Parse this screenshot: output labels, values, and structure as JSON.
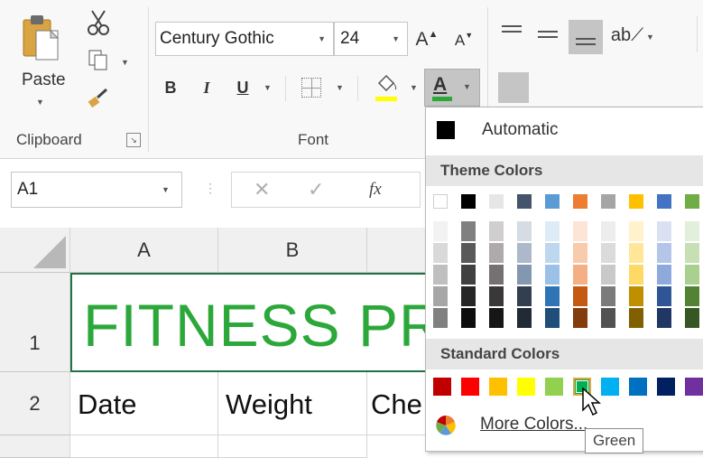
{
  "clipboard": {
    "paste_label": "Paste",
    "group_label": "Clipboard"
  },
  "font": {
    "font_name": "Century Gothic",
    "font_size": "24",
    "grow_label": "A",
    "shrink_label": "A",
    "bold_label": "B",
    "italic_label": "I",
    "underline_label": "U",
    "font_color_label": "A",
    "group_label": "Font",
    "font_color_accent": "#2ca83a",
    "highlight_accent": "#ffff00"
  },
  "formula_bar": {
    "name_box": "A1",
    "fx_label": "fx"
  },
  "sheet": {
    "columns": [
      "A",
      "B"
    ],
    "rows": [
      "1",
      "2"
    ],
    "title_text": "FITNESS PR",
    "title_color": "#2ca83a",
    "row2": [
      "Date",
      "Weight",
      "Che"
    ]
  },
  "color_menu": {
    "automatic_label": "Automatic",
    "theme_header": "Theme Colors",
    "standard_header": "Standard Colors",
    "more_colors_label": "More Colors...",
    "tooltip": "Green",
    "theme_top": [
      "#ffffff",
      "#000000",
      "#e7e6e6",
      "#44546a",
      "#5b9bd5",
      "#ed7d31",
      "#a5a5a5",
      "#ffc000",
      "#4472c4",
      "#70ad47"
    ],
    "theme_shades": [
      [
        "#f2f2f2",
        "#d9d9d9",
        "#bfbfbf",
        "#a6a6a6",
        "#808080"
      ],
      [
        "#808080",
        "#595959",
        "#404040",
        "#262626",
        "#0d0d0d"
      ],
      [
        "#d0cece",
        "#aeaaaa",
        "#757171",
        "#3a3838",
        "#171616"
      ],
      [
        "#d6dce4",
        "#adb9ca",
        "#8497b0",
        "#333f4f",
        "#222a35"
      ],
      [
        "#ddebf7",
        "#bdd7ee",
        "#9bc2e6",
        "#2f75b5",
        "#1f4e78"
      ],
      [
        "#fce4d6",
        "#f8cbad",
        "#f4b084",
        "#c65911",
        "#833c0c"
      ],
      [
        "#ededed",
        "#dbdbdb",
        "#c9c9c9",
        "#7b7b7b",
        "#525252"
      ],
      [
        "#fff2cc",
        "#ffe699",
        "#ffd966",
        "#bf8f00",
        "#806000"
      ],
      [
        "#d9e1f2",
        "#b4c6e7",
        "#8ea9db",
        "#2f5597",
        "#203764"
      ],
      [
        "#e2efda",
        "#c6e0b4",
        "#a9d08e",
        "#548235",
        "#375623"
      ]
    ],
    "standard": [
      "#c00000",
      "#ff0000",
      "#ffc000",
      "#ffff00",
      "#92d050",
      "#00b050",
      "#00b0f0",
      "#0070c0",
      "#002060",
      "#7030a0"
    ],
    "selected_standard": "Green"
  }
}
